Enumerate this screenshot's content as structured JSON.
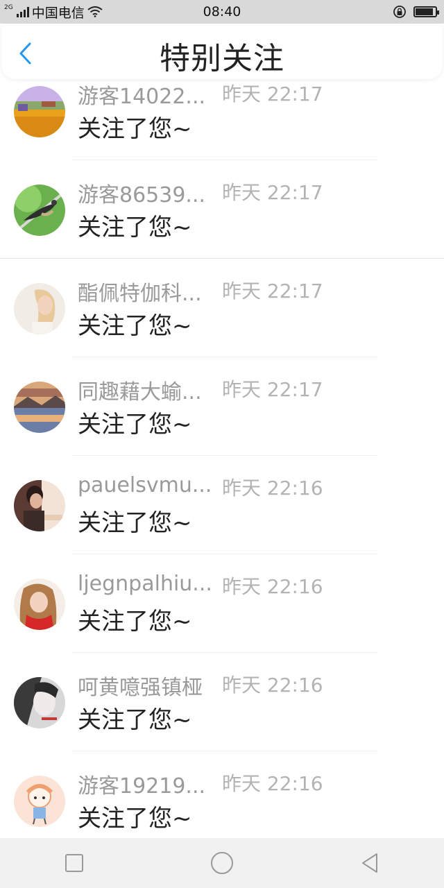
{
  "status_bar": {
    "carrier": "中国电信",
    "network": "2G",
    "time": "08:40",
    "battery_level": 0.9
  },
  "nav": {
    "title": "特别关注",
    "back_icon": "chevron-left-icon",
    "accent_color": "#2196f3"
  },
  "items": [
    {
      "name": "游客14022...",
      "time": "昨天 22:17",
      "message": "关注了您~",
      "avatar": "landscape-flowers"
    },
    {
      "name": "游客86539...",
      "time": "昨天 22:17",
      "message": "关注了您~",
      "avatar": "bird-on-branch"
    },
    {
      "name": "酯佩特伽科...",
      "time": "昨天 22:17",
      "message": "关注了您~",
      "avatar": "girl-portrait"
    },
    {
      "name": "同趣藉大蝓...",
      "time": "昨天 22:17",
      "message": "关注了您~",
      "avatar": "lake-sunset"
    },
    {
      "name": "pauelsvmu...",
      "time": "昨天 22:16",
      "message": "关注了您~",
      "avatar": "man-portrait"
    },
    {
      "name": "ljegnpalhiu...",
      "time": "昨天 22:16",
      "message": "关注了您~",
      "avatar": "girl-red-scarf"
    },
    {
      "name": "呵黄噫强镇桠",
      "time": "昨天 22:16",
      "message": "关注了您~",
      "avatar": "girl-bw"
    },
    {
      "name": "游客19219...",
      "time": "昨天 22:16",
      "message": "关注了您~",
      "avatar": "cartoon-girl"
    }
  ],
  "system_nav": {
    "recent_icon": "square-icon",
    "home_icon": "circle-icon",
    "back_icon": "triangle-back-icon"
  }
}
